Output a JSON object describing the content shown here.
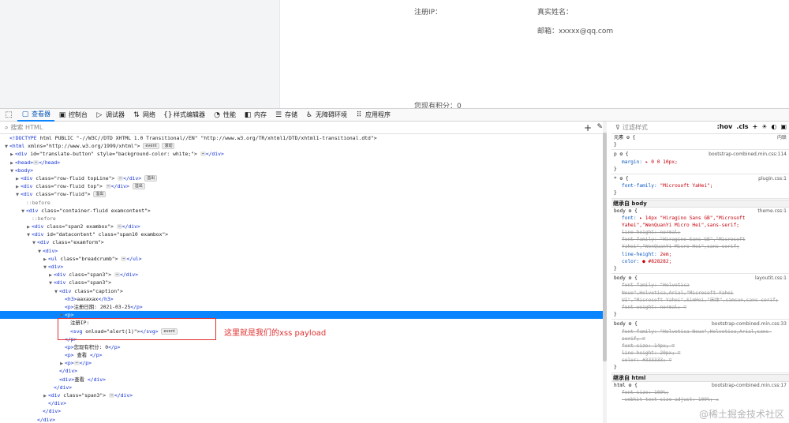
{
  "page": {
    "reg_ip_label": "注册IP：",
    "real_name_label": "真实姓名：",
    "email_label": "邮箱：xxxxx@qq.com",
    "points_label": "您现有积分：0"
  },
  "devtools": {
    "tabs": [
      {
        "icon": "▢",
        "label": "查看器",
        "active": true
      },
      {
        "icon": "▣",
        "label": "控制台"
      },
      {
        "icon": "▷",
        "label": "调试器"
      },
      {
        "icon": "⇅",
        "label": "网络"
      },
      {
        "icon": "{}",
        "label": "样式编辑器"
      },
      {
        "icon": "◔",
        "label": "性能"
      },
      {
        "icon": "◧",
        "label": "内存"
      },
      {
        "icon": "☰",
        "label": "存储"
      },
      {
        "icon": "♿",
        "label": "无障碍环境"
      },
      {
        "icon": "⠿",
        "label": "应用程序"
      }
    ],
    "search_placeholder": "搜索 HTML",
    "filter_placeholder": "过滤样式",
    "rules_tools": [
      ":hov",
      ".cls",
      "+",
      "☀",
      "◐",
      "▣"
    ]
  },
  "markup": {
    "annotation": "这里就是我们的xss payload",
    "lines": [
      {
        "t": "<!DOCTYPE html PUBLIC \"-//W3C//DTD XHTML 1.0 Transitional//EN\" \"http://www.w3.org/TR/xhtml1/DTD/xhtml1-transitional.dtd\">"
      },
      {
        "t": "<html xmlns=\"http://www.w3.org/1999/xhtml\">",
        "badge": "event",
        "badge2": "滚动"
      },
      {
        "t": "<div id=\"translate-button\" style=\"background-color: white;\"> ⋯ </div>"
      },
      {
        "t": "<head> ⋯ </head>"
      },
      {
        "t": "<body>"
      },
      {
        "t": "<div class=\"row-fluid topLine\"> ⋯ </div>",
        "badge": "溢出"
      },
      {
        "t": "<div class=\"row-fluid top\"> ⋯ </div>",
        "badge": "溢出"
      },
      {
        "t": "<div class=\"row-fluid\">",
        "badge": "溢出"
      },
      {
        "t": "::before"
      },
      {
        "t": "<div class=\"container-fluid examcontent\">"
      },
      {
        "t": "::before"
      },
      {
        "t": "<div class=\"span2 exambox\"> ⋯ </div>"
      },
      {
        "t": "<div id=\"datacontent\" class=\"span10 exambox\">"
      },
      {
        "t": "<div class=\"examform\">"
      },
      {
        "t": "<div>"
      },
      {
        "t": "<ul class=\"breadcrumb\"> ⋯ </ul>"
      },
      {
        "t": "<div>"
      },
      {
        "t": "<div class=\"span3\"> ⋯ </div>"
      },
      {
        "t": "<div class=\"span3\">"
      },
      {
        "t": "<div class=\"caption\">"
      },
      {
        "t": "<h3>aaxaxax</h3>"
      },
      {
        "t": "<p>注册日期: 2021-03-25</p>"
      },
      {
        "t": "<p>"
      },
      {
        "t": "注册IP:"
      },
      {
        "t": "<svg onload=\"alert(1)\"></svg>",
        "badge": "event"
      },
      {
        "t": "</p>"
      },
      {
        "t": "<p>您现有积分: 0</p>"
      },
      {
        "t": "<p> 查看 </p>"
      },
      {
        "t": "<p> ⋯ </p>"
      },
      {
        "t": "</div>"
      },
      {
        "t": "<div>查看 </div>"
      },
      {
        "t": "</div>"
      },
      {
        "t": "<div class=\"span3\"> ⋯ </div>"
      },
      {
        "t": "</div>"
      },
      {
        "t": "</div>"
      },
      {
        "t": "</div>"
      }
    ]
  },
  "rules": {
    "lines": [
      {
        "k": "plain",
        "t": "元素 ⚙ {",
        "src": "内联"
      },
      {
        "k": "plain",
        "t": "}"
      },
      {
        "k": "plain",
        "t": "p ⚙ {",
        "src": "bootstrap-combined.min.css:114"
      },
      {
        "k": "decl",
        "p": "margin",
        "v": "▸ 0 0 10px;"
      },
      {
        "k": "plain",
        "t": "}"
      },
      {
        "k": "plain",
        "t": "* ⚙ {",
        "src": "plugin.css:1"
      },
      {
        "k": "decl",
        "p": "font-family",
        "v": "\"Microsoft YaHei\";"
      },
      {
        "k": "plain",
        "t": "}"
      },
      {
        "k": "inh",
        "t": "继承自 body"
      },
      {
        "k": "plain",
        "t": "body ⚙ {",
        "src": "theme.css:1"
      },
      {
        "k": "decl",
        "p": "font",
        "v": "▸ 14px \"Hiragino Sans GB\",\"Microsoft"
      },
      {
        "k": "cont",
        "t": "   Yahei\",\"WenQuanYi Micro Hei\",sans-serif;"
      },
      {
        "k": "strike",
        "t": "     line-height: normal;"
      },
      {
        "k": "strike",
        "t": "     font-family: \"Hiragino Sans GB\",\"Microsoft"
      },
      {
        "k": "strike",
        "t": "       Yahei\",\"WenQuanYi Micro Hei\",sans-serif;"
      },
      {
        "k": "decl",
        "p": "line-height",
        "v": "2em;"
      },
      {
        "k": "decl",
        "p": "color",
        "v": "● #828282;"
      },
      {
        "k": "plain",
        "t": "}"
      },
      {
        "k": "plain",
        "t": "body ⚙ {",
        "src": "layoutit.css:1"
      },
      {
        "k": "strike",
        "t": " font-family: \"Helvetica"
      },
      {
        "k": "strike",
        "t": "      Neue\",Helvetica,Arial,\"Microsoft Yahei"
      },
      {
        "k": "strike",
        "t": " UI\",\"Microsoft Yahei\",SimHei,\"宋体\",simsun,sans-serif;"
      },
      {
        "k": "strike",
        "t": " font-weight: normal;  ▽"
      },
      {
        "k": "plain",
        "t": "}"
      },
      {
        "k": "plain",
        "t": "body ⚙ {",
        "src": "bootstrap-combined.min.css:33"
      },
      {
        "k": "strike",
        "t": " font-family: \"Helvetica Neue\",Helvetica,Arial,sans-"
      },
      {
        "k": "strike",
        "t": "      serif;  ▽"
      },
      {
        "k": "strike",
        "t": " font-size: 14px;  ▽"
      },
      {
        "k": "strike",
        "t": " line-height: 20px;  ▽"
      },
      {
        "k": "strike",
        "t": " color: #333333;  ▽"
      },
      {
        "k": "plain",
        "t": "}"
      },
      {
        "k": "inh",
        "t": "继承自 html"
      },
      {
        "k": "plain",
        "t": "html ⚙ {",
        "src": "bootstrap-combined.min.css:17"
      },
      {
        "k": "strike",
        "t": " font-size: 100%;"
      },
      {
        "k": "strike",
        "t": " -webkit-text-size-adjust: 100%; ⚠"
      }
    ]
  },
  "watermark": "@稀土掘金技术社区"
}
